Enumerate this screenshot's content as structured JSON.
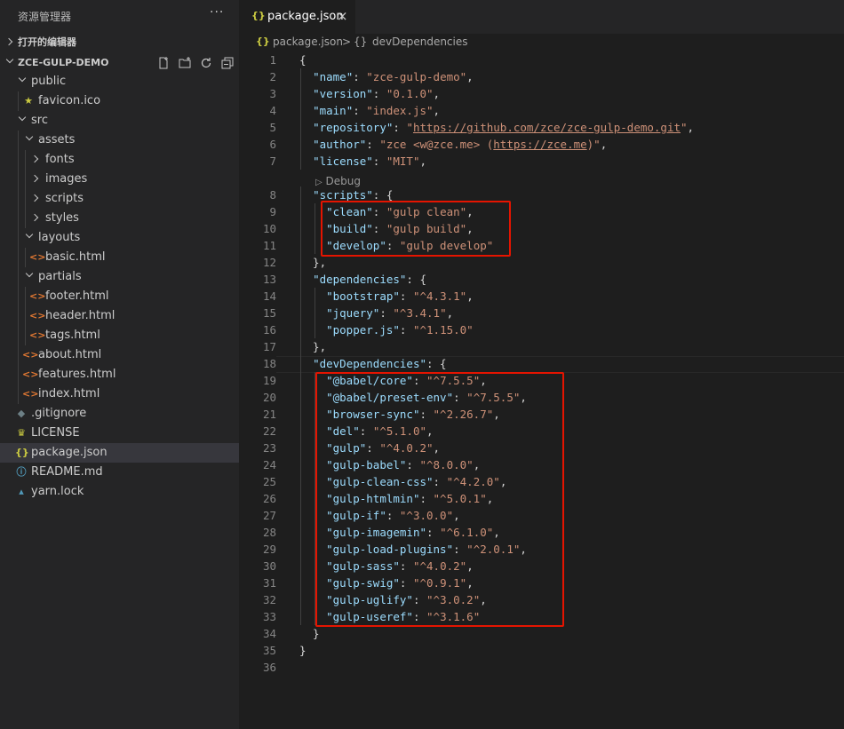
{
  "sidebar": {
    "title": "资源管理器",
    "more": "···",
    "open_editors": "打开的编辑器",
    "project": "ZCE-GULP-DEMO",
    "tree": [
      {
        "label": "public",
        "type": "folder",
        "open": true,
        "depth": 1
      },
      {
        "label": "favicon.ico",
        "type": "file",
        "icon": "★",
        "icon_color": "#cbcb41",
        "depth": 2,
        "selected": false
      },
      {
        "label": "src",
        "type": "folder",
        "open": true,
        "depth": 1
      },
      {
        "label": "assets",
        "type": "folder",
        "open": true,
        "depth": 2
      },
      {
        "label": "fonts",
        "type": "folder",
        "open": false,
        "depth": 3
      },
      {
        "label": "images",
        "type": "folder",
        "open": false,
        "depth": 3
      },
      {
        "label": "scripts",
        "type": "folder",
        "open": false,
        "depth": 3
      },
      {
        "label": "styles",
        "type": "folder",
        "open": false,
        "depth": 3
      },
      {
        "label": "layouts",
        "type": "folder",
        "open": true,
        "depth": 2
      },
      {
        "label": "basic.html",
        "type": "file",
        "icon": "<>",
        "icon_color": "#e37933",
        "depth": 3
      },
      {
        "label": "partials",
        "type": "folder",
        "open": true,
        "depth": 2
      },
      {
        "label": "footer.html",
        "type": "file",
        "icon": "<>",
        "icon_color": "#e37933",
        "depth": 3
      },
      {
        "label": "header.html",
        "type": "file",
        "icon": "<>",
        "icon_color": "#e37933",
        "depth": 3
      },
      {
        "label": "tags.html",
        "type": "file",
        "icon": "<>",
        "icon_color": "#e37933",
        "depth": 3
      },
      {
        "label": "about.html",
        "type": "file",
        "icon": "<>",
        "icon_color": "#e37933",
        "depth": 2
      },
      {
        "label": "features.html",
        "type": "file",
        "icon": "<>",
        "icon_color": "#e37933",
        "depth": 2
      },
      {
        "label": "index.html",
        "type": "file",
        "icon": "<>",
        "icon_color": "#e37933",
        "depth": 2
      },
      {
        "label": ".gitignore",
        "type": "file",
        "icon": "◆",
        "icon_color": "#6d8086",
        "depth": 1
      },
      {
        "label": "LICENSE",
        "type": "file",
        "icon": "♛",
        "icon_color": "#cbcb41",
        "depth": 1
      },
      {
        "label": "package.json",
        "type": "file",
        "icon": "{}",
        "icon_color": "#cbcb41",
        "depth": 1,
        "selected": true
      },
      {
        "label": "README.md",
        "type": "file",
        "icon": "ⓘ",
        "icon_color": "#519aba",
        "depth": 1
      },
      {
        "label": "yarn.lock",
        "type": "file",
        "icon": "▴",
        "icon_color": "#519aba",
        "depth": 1
      }
    ]
  },
  "tab": {
    "icon": "{}",
    "label": "package.json",
    "close": "×"
  },
  "breadcrumb": {
    "file": "package.json",
    "sep": ">",
    "icon": "{}",
    "node": "devDependencies"
  },
  "codelens": "Debug",
  "editor": {
    "lines": [
      [
        [
          "p",
          "{"
        ]
      ],
      [
        [
          "p",
          "  "
        ],
        [
          "k",
          "\"name\""
        ],
        [
          "p",
          ": "
        ],
        [
          "s",
          "\"zce-gulp-demo\""
        ],
        [
          "p",
          ","
        ]
      ],
      [
        [
          "p",
          "  "
        ],
        [
          "k",
          "\"version\""
        ],
        [
          "p",
          ": "
        ],
        [
          "s",
          "\"0.1.0\""
        ],
        [
          "p",
          ","
        ]
      ],
      [
        [
          "p",
          "  "
        ],
        [
          "k",
          "\"main\""
        ],
        [
          "p",
          ": "
        ],
        [
          "s",
          "\"index.js\""
        ],
        [
          "p",
          ","
        ]
      ],
      [
        [
          "p",
          "  "
        ],
        [
          "k",
          "\"repository\""
        ],
        [
          "p",
          ": "
        ],
        [
          "s",
          "\""
        ],
        [
          "u",
          "https://github.com/zce/zce-gulp-demo.git"
        ],
        [
          "s",
          "\""
        ],
        [
          "p",
          ","
        ]
      ],
      [
        [
          "p",
          "  "
        ],
        [
          "k",
          "\"author\""
        ],
        [
          "p",
          ": "
        ],
        [
          "s",
          "\"zce <w@zce.me> ("
        ],
        [
          "u",
          "https://zce.me"
        ],
        [
          "s",
          ")\""
        ],
        [
          "p",
          ","
        ]
      ],
      [
        [
          "p",
          "  "
        ],
        [
          "k",
          "\"license\""
        ],
        [
          "p",
          ": "
        ],
        [
          "s",
          "\"MIT\""
        ],
        [
          "p",
          ","
        ]
      ],
      [
        [
          "p",
          "  "
        ],
        [
          "k",
          "\"scripts\""
        ],
        [
          "p",
          ": {"
        ]
      ],
      [
        [
          "p",
          "    "
        ],
        [
          "k",
          "\"clean\""
        ],
        [
          "p",
          ": "
        ],
        [
          "s",
          "\"gulp clean\""
        ],
        [
          "p",
          ","
        ]
      ],
      [
        [
          "p",
          "    "
        ],
        [
          "k",
          "\"build\""
        ],
        [
          "p",
          ": "
        ],
        [
          "s",
          "\"gulp build\""
        ],
        [
          "p",
          ","
        ]
      ],
      [
        [
          "p",
          "    "
        ],
        [
          "k",
          "\"develop\""
        ],
        [
          "p",
          ": "
        ],
        [
          "s",
          "\"gulp develop\""
        ]
      ],
      [
        [
          "p",
          "  },"
        ]
      ],
      [
        [
          "p",
          "  "
        ],
        [
          "k",
          "\"dependencies\""
        ],
        [
          "p",
          ": {"
        ]
      ],
      [
        [
          "p",
          "    "
        ],
        [
          "k",
          "\"bootstrap\""
        ],
        [
          "p",
          ": "
        ],
        [
          "s",
          "\"^4.3.1\""
        ],
        [
          "p",
          ","
        ]
      ],
      [
        [
          "p",
          "    "
        ],
        [
          "k",
          "\"jquery\""
        ],
        [
          "p",
          ": "
        ],
        [
          "s",
          "\"^3.4.1\""
        ],
        [
          "p",
          ","
        ]
      ],
      [
        [
          "p",
          "    "
        ],
        [
          "k",
          "\"popper.js\""
        ],
        [
          "p",
          ": "
        ],
        [
          "s",
          "\"^1.15.0\""
        ]
      ],
      [
        [
          "p",
          "  },"
        ]
      ],
      [
        [
          "p",
          "  "
        ],
        [
          "k",
          "\"devDependencies\""
        ],
        [
          "p",
          ": {"
        ]
      ],
      [
        [
          "p",
          "    "
        ],
        [
          "k",
          "\"@babel/core\""
        ],
        [
          "p",
          ": "
        ],
        [
          "s",
          "\"^7.5.5\""
        ],
        [
          "p",
          ","
        ]
      ],
      [
        [
          "p",
          "    "
        ],
        [
          "k",
          "\"@babel/preset-env\""
        ],
        [
          "p",
          ": "
        ],
        [
          "s",
          "\"^7.5.5\""
        ],
        [
          "p",
          ","
        ]
      ],
      [
        [
          "p",
          "    "
        ],
        [
          "k",
          "\"browser-sync\""
        ],
        [
          "p",
          ": "
        ],
        [
          "s",
          "\"^2.26.7\""
        ],
        [
          "p",
          ","
        ]
      ],
      [
        [
          "p",
          "    "
        ],
        [
          "k",
          "\"del\""
        ],
        [
          "p",
          ": "
        ],
        [
          "s",
          "\"^5.1.0\""
        ],
        [
          "p",
          ","
        ]
      ],
      [
        [
          "p",
          "    "
        ],
        [
          "k",
          "\"gulp\""
        ],
        [
          "p",
          ": "
        ],
        [
          "s",
          "\"^4.0.2\""
        ],
        [
          "p",
          ","
        ]
      ],
      [
        [
          "p",
          "    "
        ],
        [
          "k",
          "\"gulp-babel\""
        ],
        [
          "p",
          ": "
        ],
        [
          "s",
          "\"^8.0.0\""
        ],
        [
          "p",
          ","
        ]
      ],
      [
        [
          "p",
          "    "
        ],
        [
          "k",
          "\"gulp-clean-css\""
        ],
        [
          "p",
          ": "
        ],
        [
          "s",
          "\"^4.2.0\""
        ],
        [
          "p",
          ","
        ]
      ],
      [
        [
          "p",
          "    "
        ],
        [
          "k",
          "\"gulp-htmlmin\""
        ],
        [
          "p",
          ": "
        ],
        [
          "s",
          "\"^5.0.1\""
        ],
        [
          "p",
          ","
        ]
      ],
      [
        [
          "p",
          "    "
        ],
        [
          "k",
          "\"gulp-if\""
        ],
        [
          "p",
          ": "
        ],
        [
          "s",
          "\"^3.0.0\""
        ],
        [
          "p",
          ","
        ]
      ],
      [
        [
          "p",
          "    "
        ],
        [
          "k",
          "\"gulp-imagemin\""
        ],
        [
          "p",
          ": "
        ],
        [
          "s",
          "\"^6.1.0\""
        ],
        [
          "p",
          ","
        ]
      ],
      [
        [
          "p",
          "    "
        ],
        [
          "k",
          "\"gulp-load-plugins\""
        ],
        [
          "p",
          ": "
        ],
        [
          "s",
          "\"^2.0.1\""
        ],
        [
          "p",
          ","
        ]
      ],
      [
        [
          "p",
          "    "
        ],
        [
          "k",
          "\"gulp-sass\""
        ],
        [
          "p",
          ": "
        ],
        [
          "s",
          "\"^4.0.2\""
        ],
        [
          "p",
          ","
        ]
      ],
      [
        [
          "p",
          "    "
        ],
        [
          "k",
          "\"gulp-swig\""
        ],
        [
          "p",
          ": "
        ],
        [
          "s",
          "\"^0.9.1\""
        ],
        [
          "p",
          ","
        ]
      ],
      [
        [
          "p",
          "    "
        ],
        [
          "k",
          "\"gulp-uglify\""
        ],
        [
          "p",
          ": "
        ],
        [
          "s",
          "\"^3.0.2\""
        ],
        [
          "p",
          ","
        ]
      ],
      [
        [
          "p",
          "    "
        ],
        [
          "k",
          "\"gulp-useref\""
        ],
        [
          "p",
          ": "
        ],
        [
          "s",
          "\"^3.1.6\""
        ]
      ],
      [
        [
          "p",
          "  }"
        ]
      ],
      [
        [
          "p",
          "}"
        ]
      ],
      []
    ]
  },
  "colors": {
    "highlight_box": "#e51400",
    "accent": "#cbcb41"
  }
}
